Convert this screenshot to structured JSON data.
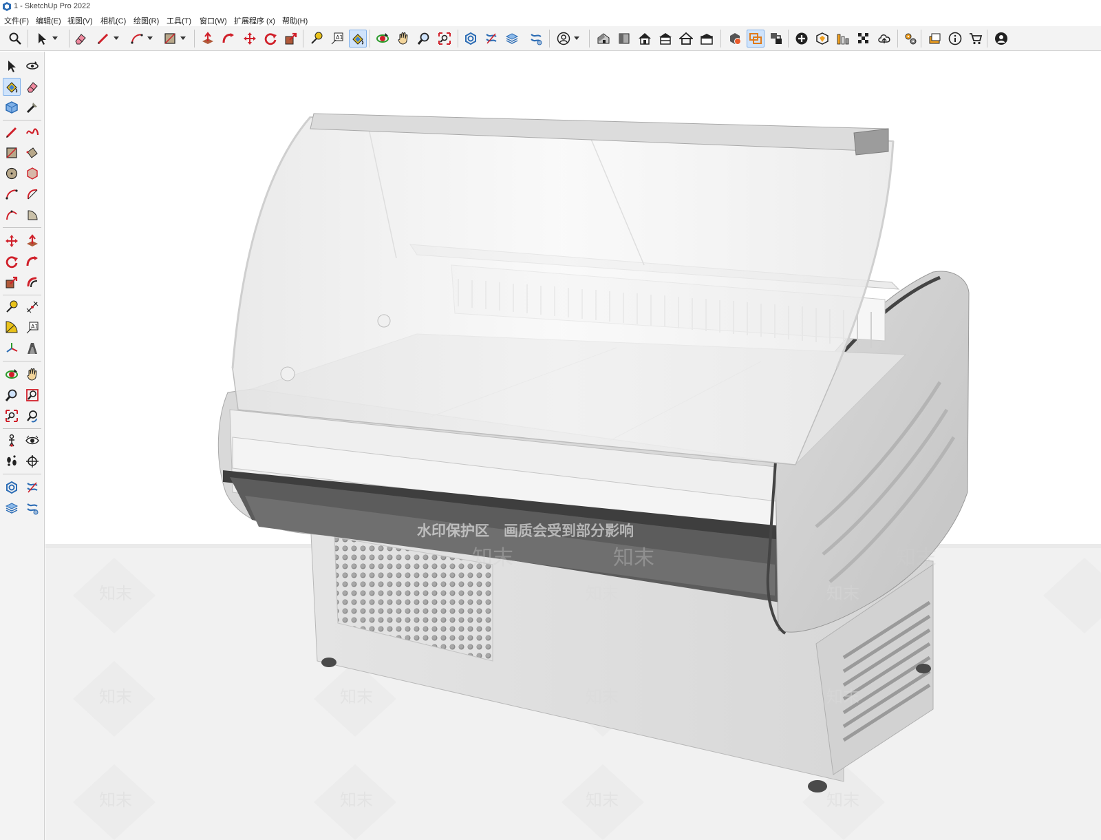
{
  "window": {
    "title": "1 - SketchUp Pro 2022"
  },
  "menu": [
    {
      "id": "file",
      "label": "文件(F)"
    },
    {
      "id": "edit",
      "label": "编辑(E)"
    },
    {
      "id": "view",
      "label": "视图(V)"
    },
    {
      "id": "camera",
      "label": "相机(C)"
    },
    {
      "id": "draw",
      "label": "绘图(R)"
    },
    {
      "id": "tools",
      "label": "工具(T)"
    },
    {
      "id": "window",
      "label": "窗口(W)"
    },
    {
      "id": "extensions",
      "label": "扩展程序 (x)"
    },
    {
      "id": "help",
      "label": "帮助(H)"
    }
  ],
  "top_toolbar": [
    {
      "id": "zoom-window",
      "icon": "magnifier"
    },
    {
      "id": "select",
      "icon": "arrow",
      "dropdown": true
    },
    {
      "id": "eraser",
      "icon": "eraser"
    },
    {
      "id": "line",
      "icon": "pencil",
      "dropdown": true
    },
    {
      "id": "arc",
      "icon": "arc",
      "dropdown": true
    },
    {
      "id": "rectangle",
      "icon": "rectangle",
      "dropdown": true
    },
    {
      "id": "push-pull",
      "icon": "pushpull"
    },
    {
      "id": "follow-me",
      "icon": "followme"
    },
    {
      "id": "move",
      "icon": "move"
    },
    {
      "id": "rotate",
      "icon": "rotate"
    },
    {
      "id": "scale",
      "icon": "scale"
    },
    {
      "id": "tape-measure",
      "icon": "tape"
    },
    {
      "id": "text",
      "icon": "text"
    },
    {
      "id": "paint-bucket",
      "icon": "paint",
      "active": true
    },
    {
      "id": "orbit",
      "icon": "orbit"
    },
    {
      "id": "pan",
      "icon": "hand"
    },
    {
      "id": "zoom",
      "icon": "zoom"
    },
    {
      "id": "zoom-extents",
      "icon": "zoomext"
    },
    {
      "id": "warehouse-a",
      "icon": "net"
    },
    {
      "id": "warehouse-b",
      "icon": "netx"
    },
    {
      "id": "warehouse-c",
      "icon": "layers"
    },
    {
      "id": "warehouse-d",
      "icon": "netgear"
    },
    {
      "id": "account",
      "icon": "person",
      "dropdown": true
    },
    {
      "id": "view-iso",
      "icon": "house3d"
    },
    {
      "id": "view-top",
      "icon": "book"
    },
    {
      "id": "view-front",
      "icon": "home"
    },
    {
      "id": "view-right",
      "icon": "homeshelf"
    },
    {
      "id": "view-back",
      "icon": "homeoutline"
    },
    {
      "id": "view-left",
      "icon": "homebox"
    },
    {
      "id": "solid-outer",
      "icon": "solidbox"
    },
    {
      "id": "section-plane",
      "icon": "sectionorange",
      "active": true
    },
    {
      "id": "section-display",
      "icon": "sectioncam"
    },
    {
      "id": "add-location",
      "icon": "pluscircle"
    },
    {
      "id": "photo-textures",
      "icon": "shieldbox"
    },
    {
      "id": "building-maker",
      "icon": "bars"
    },
    {
      "id": "checker",
      "icon": "checker"
    },
    {
      "id": "cloud",
      "icon": "cloud"
    },
    {
      "id": "extension-manager",
      "icon": "gears"
    },
    {
      "id": "sidebar-toggle",
      "icon": "panel"
    },
    {
      "id": "info",
      "icon": "info"
    },
    {
      "id": "store",
      "icon": "cart"
    },
    {
      "id": "profile",
      "icon": "profile"
    }
  ],
  "left_toolbar": [
    [
      {
        "id": "select",
        "icon": "arrow"
      },
      {
        "id": "orbit-select",
        "icon": "orbitsmall"
      }
    ],
    [
      {
        "id": "paint",
        "icon": "paint",
        "active": true
      },
      {
        "id": "eraser",
        "icon": "eraser"
      }
    ],
    [
      {
        "id": "component",
        "icon": "boxblue"
      },
      {
        "id": "sample",
        "icon": "dropper"
      }
    ],
    [
      {
        "id": "line",
        "icon": "pencil"
      },
      {
        "id": "freehand",
        "icon": "freehand"
      }
    ],
    [
      {
        "id": "rectangle",
        "icon": "rectangle"
      },
      {
        "id": "rotated-rectangle",
        "icon": "rectrot"
      }
    ],
    [
      {
        "id": "circle",
        "icon": "circle"
      },
      {
        "id": "polygon",
        "icon": "polygon"
      }
    ],
    [
      {
        "id": "arc",
        "icon": "arc"
      },
      {
        "id": "arc-2pt",
        "icon": "arc2"
      }
    ],
    [
      {
        "id": "arc-3pt",
        "icon": "arc3"
      },
      {
        "id": "pie",
        "icon": "pie"
      }
    ],
    [
      {
        "id": "move",
        "icon": "move"
      },
      {
        "id": "push-pull",
        "icon": "pushpull"
      }
    ],
    [
      {
        "id": "rotate",
        "icon": "rotate"
      },
      {
        "id": "follow-me",
        "icon": "followme"
      }
    ],
    [
      {
        "id": "scale",
        "icon": "scale"
      },
      {
        "id": "offset",
        "icon": "offset"
      }
    ],
    [
      {
        "id": "tape-measure",
        "icon": "tape"
      },
      {
        "id": "dimension",
        "icon": "dimension"
      }
    ],
    [
      {
        "id": "protractor",
        "icon": "protractor"
      },
      {
        "id": "text",
        "icon": "text"
      }
    ],
    [
      {
        "id": "axes",
        "icon": "axes"
      },
      {
        "id": "3d-text",
        "icon": "text3d"
      }
    ],
    [
      {
        "id": "orbit",
        "icon": "orbit"
      },
      {
        "id": "pan",
        "icon": "hand"
      }
    ],
    [
      {
        "id": "zoom",
        "icon": "zoom"
      },
      {
        "id": "zoom-window",
        "icon": "zoomwin"
      }
    ],
    [
      {
        "id": "zoom-extents",
        "icon": "zoomext"
      },
      {
        "id": "previous",
        "icon": "previous"
      }
    ],
    [
      {
        "id": "position-camera",
        "icon": "figure"
      },
      {
        "id": "look-around",
        "icon": "eye"
      }
    ],
    [
      {
        "id": "walk",
        "icon": "feet"
      },
      {
        "id": "section",
        "icon": "sectiontool"
      }
    ],
    [
      {
        "id": "warehouse-a",
        "icon": "net"
      },
      {
        "id": "warehouse-b",
        "icon": "netx"
      }
    ],
    [
      {
        "id": "warehouse-c",
        "icon": "layers"
      },
      {
        "id": "warehouse-d",
        "icon": "netgear"
      }
    ]
  ],
  "left_separators_after_rows": [
    2,
    7,
    10,
    13,
    16,
    18
  ],
  "viewport": {
    "model": "curved-glass-refrigerated-display-counter",
    "watermark_text": "水印保护区　画质会受到部分影响",
    "watermark_logo": "知末"
  },
  "colors": {
    "toolbar_bg": "#f3f3f3",
    "active_bg": "#cfe3fb",
    "active_border": "#7fb0ea",
    "tool_red": "#d0202a",
    "tool_blue": "#2d6db5",
    "tool_yellow": "#e9c21a",
    "viewport_bg": "#ffffff",
    "ground": "#f0f0f0"
  }
}
